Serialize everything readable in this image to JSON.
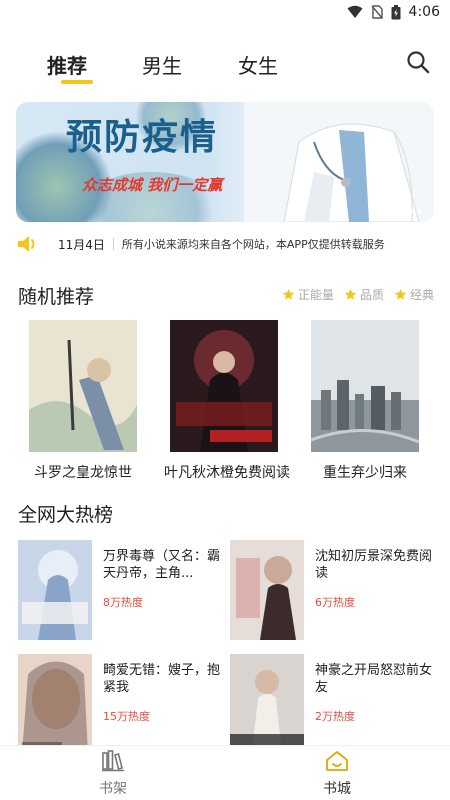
{
  "status_bar": {
    "time": "4:06"
  },
  "tabs": [
    {
      "label": "推荐",
      "active": true
    },
    {
      "label": "男生",
      "active": false
    },
    {
      "label": "女生",
      "active": false
    }
  ],
  "banner": {
    "title": "预防疫情",
    "subtitle": "众志成城 我们一定赢"
  },
  "notice": {
    "date": "11月4日",
    "text": "所有小说来源均来自各个网站，本APP仅提供转载服务"
  },
  "random_section": {
    "title": "随机推荐",
    "filters": [
      "正能量",
      "品质",
      "经典"
    ]
  },
  "recommend_books": [
    {
      "title": "斗罗之皇龙惊世"
    },
    {
      "title": "叶凡秋沐橙免费阅读"
    },
    {
      "title": "重生弃少归来"
    }
  ],
  "hot_section": {
    "title": "全网大热榜"
  },
  "hot_books": [
    {
      "title": "万界毒尊（又名：霸天丹帝，主角...",
      "heat": "8万热度"
    },
    {
      "title": "沈知初厉景深免费阅读",
      "heat": "6万热度"
    },
    {
      "title": "畸爱无错：嫂子，抱紧我",
      "heat": "15万热度"
    },
    {
      "title": "神豪之开局怒怼前女友",
      "heat": "2万热度"
    }
  ],
  "bottom_nav": [
    {
      "label": "书架",
      "icon": "bookshelf-icon"
    },
    {
      "label": "书城",
      "icon": "home-icon"
    }
  ],
  "colors": {
    "accent": "#f5c518",
    "heat": "#e84b3c",
    "nav_active": "#e0a800"
  }
}
